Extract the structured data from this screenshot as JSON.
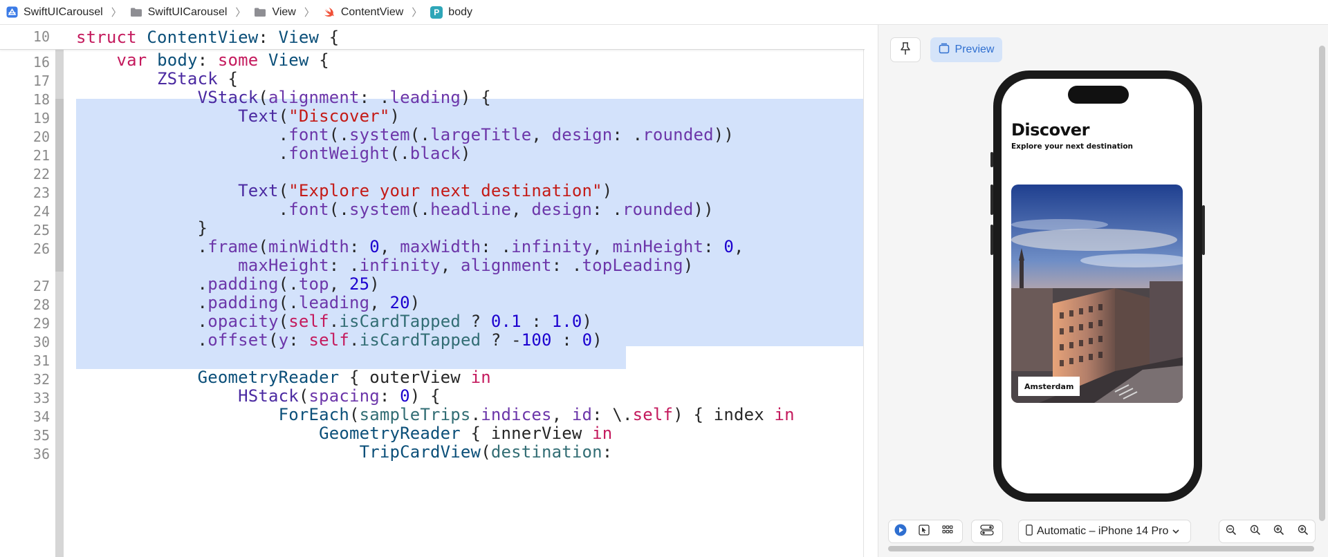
{
  "breadcrumb": {
    "items": [
      {
        "label": "SwiftUICarousel",
        "icon": "app-project-icon"
      },
      {
        "label": "SwiftUICarousel",
        "icon": "folder-icon"
      },
      {
        "label": "View",
        "icon": "folder-icon"
      },
      {
        "label": "ContentView",
        "icon": "swift-file-icon"
      },
      {
        "label": "body",
        "icon": "property-icon"
      }
    ],
    "property_badge": "P"
  },
  "editor": {
    "sticky": {
      "number": "10",
      "segments": [
        {
          "t": "struct",
          "c": "kw"
        },
        {
          "t": " ",
          "c": "pl"
        },
        {
          "t": "ContentView",
          "c": "ty"
        },
        {
          "t": ": ",
          "c": "pl"
        },
        {
          "t": "View",
          "c": "ty"
        },
        {
          "t": " {",
          "c": "pl"
        }
      ]
    },
    "lines": [
      {
        "number": "16",
        "segments": [
          {
            "t": "    ",
            "c": "pl"
          },
          {
            "t": "var",
            "c": "kw"
          },
          {
            "t": " ",
            "c": "pl"
          },
          {
            "t": "body",
            "c": "ty"
          },
          {
            "t": ": ",
            "c": "pl"
          },
          {
            "t": "some",
            "c": "kw"
          },
          {
            "t": " ",
            "c": "pl"
          },
          {
            "t": "View",
            "c": "ty"
          },
          {
            "t": " {",
            "c": "pl"
          }
        ]
      },
      {
        "number": "17",
        "segments": [
          {
            "t": "        ",
            "c": "pl"
          },
          {
            "t": "ZStack",
            "c": "fn"
          },
          {
            "t": " {",
            "c": "pl"
          }
        ]
      },
      {
        "number": "18",
        "segments": [
          {
            "t": "            ",
            "c": "pl"
          },
          {
            "t": "VStack",
            "c": "fn"
          },
          {
            "t": "(",
            "c": "pl"
          },
          {
            "t": "alignment",
            "c": "prm"
          },
          {
            "t": ": .",
            "c": "pl"
          },
          {
            "t": "leading",
            "c": "mem"
          },
          {
            "t": ") {",
            "c": "pl"
          }
        ]
      },
      {
        "number": "19",
        "segments": [
          {
            "t": "                ",
            "c": "pl"
          },
          {
            "t": "Text",
            "c": "fn"
          },
          {
            "t": "(",
            "c": "pl"
          },
          {
            "t": "\"Discover\"",
            "c": "str"
          },
          {
            "t": ")",
            "c": "pl"
          }
        ]
      },
      {
        "number": "20",
        "segments": [
          {
            "t": "                    .",
            "c": "pl"
          },
          {
            "t": "font",
            "c": "mem"
          },
          {
            "t": "(.",
            "c": "pl"
          },
          {
            "t": "system",
            "c": "mem"
          },
          {
            "t": "(.",
            "c": "pl"
          },
          {
            "t": "largeTitle",
            "c": "mem"
          },
          {
            "t": ", ",
            "c": "pl"
          },
          {
            "t": "design",
            "c": "prm"
          },
          {
            "t": ": .",
            "c": "pl"
          },
          {
            "t": "rounded",
            "c": "mem"
          },
          {
            "t": "))",
            "c": "pl"
          }
        ]
      },
      {
        "number": "21",
        "segments": [
          {
            "t": "                    .",
            "c": "pl"
          },
          {
            "t": "fontWeight",
            "c": "mem"
          },
          {
            "t": "(.",
            "c": "pl"
          },
          {
            "t": "black",
            "c": "mem"
          },
          {
            "t": ")",
            "c": "pl"
          }
        ]
      },
      {
        "number": "22",
        "segments": []
      },
      {
        "number": "23",
        "segments": [
          {
            "t": "                ",
            "c": "pl"
          },
          {
            "t": "Text",
            "c": "fn"
          },
          {
            "t": "(",
            "c": "pl"
          },
          {
            "t": "\"Explore your next destination\"",
            "c": "str"
          },
          {
            "t": ")",
            "c": "pl"
          }
        ]
      },
      {
        "number": "24",
        "segments": [
          {
            "t": "                    .",
            "c": "pl"
          },
          {
            "t": "font",
            "c": "mem"
          },
          {
            "t": "(.",
            "c": "pl"
          },
          {
            "t": "system",
            "c": "mem"
          },
          {
            "t": "(.",
            "c": "pl"
          },
          {
            "t": "headline",
            "c": "mem"
          },
          {
            "t": ", ",
            "c": "pl"
          },
          {
            "t": "design",
            "c": "prm"
          },
          {
            "t": ": .",
            "c": "pl"
          },
          {
            "t": "rounded",
            "c": "mem"
          },
          {
            "t": "))",
            "c": "pl"
          }
        ]
      },
      {
        "number": "25",
        "segments": [
          {
            "t": "            }",
            "c": "pl"
          }
        ]
      },
      {
        "number": "26",
        "segments": [
          {
            "t": "            .",
            "c": "pl"
          },
          {
            "t": "frame",
            "c": "mem"
          },
          {
            "t": "(",
            "c": "pl"
          },
          {
            "t": "minWidth",
            "c": "prm"
          },
          {
            "t": ": ",
            "c": "pl"
          },
          {
            "t": "0",
            "c": "num"
          },
          {
            "t": ", ",
            "c": "pl"
          },
          {
            "t": "maxWidth",
            "c": "prm"
          },
          {
            "t": ": .",
            "c": "pl"
          },
          {
            "t": "infinity",
            "c": "mem"
          },
          {
            "t": ", ",
            "c": "pl"
          },
          {
            "t": "minHeight",
            "c": "prm"
          },
          {
            "t": ": ",
            "c": "pl"
          },
          {
            "t": "0",
            "c": "num"
          },
          {
            "t": ",",
            "c": "pl"
          }
        ]
      },
      {
        "number": "",
        "segments": [
          {
            "t": "                ",
            "c": "pl"
          },
          {
            "t": "maxHeight",
            "c": "prm"
          },
          {
            "t": ": .",
            "c": "pl"
          },
          {
            "t": "infinity",
            "c": "mem"
          },
          {
            "t": ", ",
            "c": "pl"
          },
          {
            "t": "alignment",
            "c": "prm"
          },
          {
            "t": ": .",
            "c": "pl"
          },
          {
            "t": "topLeading",
            "c": "mem"
          },
          {
            "t": ")",
            "c": "pl"
          }
        ]
      },
      {
        "number": "27",
        "segments": [
          {
            "t": "            .",
            "c": "pl"
          },
          {
            "t": "padding",
            "c": "mem"
          },
          {
            "t": "(.",
            "c": "pl"
          },
          {
            "t": "top",
            "c": "mem"
          },
          {
            "t": ", ",
            "c": "pl"
          },
          {
            "t": "25",
            "c": "num"
          },
          {
            "t": ")",
            "c": "pl"
          }
        ]
      },
      {
        "number": "28",
        "segments": [
          {
            "t": "            .",
            "c": "pl"
          },
          {
            "t": "padding",
            "c": "mem"
          },
          {
            "t": "(.",
            "c": "pl"
          },
          {
            "t": "leading",
            "c": "mem"
          },
          {
            "t": ", ",
            "c": "pl"
          },
          {
            "t": "20",
            "c": "num"
          },
          {
            "t": ")",
            "c": "pl"
          }
        ]
      },
      {
        "number": "29",
        "segments": [
          {
            "t": "            .",
            "c": "pl"
          },
          {
            "t": "opacity",
            "c": "mem"
          },
          {
            "t": "(",
            "c": "pl"
          },
          {
            "t": "self",
            "c": "kw"
          },
          {
            "t": ".",
            "c": "pl"
          },
          {
            "t": "isCardTapped",
            "c": "var"
          },
          {
            "t": " ? ",
            "c": "pl"
          },
          {
            "t": "0.1",
            "c": "num"
          },
          {
            "t": " : ",
            "c": "pl"
          },
          {
            "t": "1.0",
            "c": "num"
          },
          {
            "t": ")",
            "c": "pl"
          }
        ]
      },
      {
        "number": "30",
        "segments": [
          {
            "t": "            .",
            "c": "pl"
          },
          {
            "t": "offset",
            "c": "mem"
          },
          {
            "t": "(",
            "c": "pl"
          },
          {
            "t": "y",
            "c": "prm"
          },
          {
            "t": ": ",
            "c": "pl"
          },
          {
            "t": "self",
            "c": "kw"
          },
          {
            "t": ".",
            "c": "pl"
          },
          {
            "t": "isCardTapped",
            "c": "var"
          },
          {
            "t": " ? -",
            "c": "pl"
          },
          {
            "t": "100",
            "c": "num"
          },
          {
            "t": " : ",
            "c": "pl"
          },
          {
            "t": "0",
            "c": "num"
          },
          {
            "t": ")",
            "c": "pl"
          }
        ]
      },
      {
        "number": "31",
        "segments": []
      },
      {
        "number": "32",
        "segments": [
          {
            "t": "            ",
            "c": "pl"
          },
          {
            "t": "GeometryReader",
            "c": "ty"
          },
          {
            "t": " { outerView ",
            "c": "pl"
          },
          {
            "t": "in",
            "c": "kw"
          }
        ]
      },
      {
        "number": "33",
        "segments": [
          {
            "t": "                ",
            "c": "pl"
          },
          {
            "t": "HStack",
            "c": "fn"
          },
          {
            "t": "(",
            "c": "pl"
          },
          {
            "t": "spacing",
            "c": "prm"
          },
          {
            "t": ": ",
            "c": "pl"
          },
          {
            "t": "0",
            "c": "num"
          },
          {
            "t": ") {",
            "c": "pl"
          }
        ]
      },
      {
        "number": "34",
        "segments": [
          {
            "t": "                    ",
            "c": "pl"
          },
          {
            "t": "ForEach",
            "c": "ty"
          },
          {
            "t": "(",
            "c": "pl"
          },
          {
            "t": "sampleTrips",
            "c": "var"
          },
          {
            "t": ".",
            "c": "pl"
          },
          {
            "t": "indices",
            "c": "mem"
          },
          {
            "t": ", ",
            "c": "pl"
          },
          {
            "t": "id",
            "c": "prm"
          },
          {
            "t": ": \\.",
            "c": "pl"
          },
          {
            "t": "self",
            "c": "kw"
          },
          {
            "t": ") { index ",
            "c": "pl"
          },
          {
            "t": "in",
            "c": "kw"
          }
        ]
      },
      {
        "number": "35",
        "segments": [
          {
            "t": "                        ",
            "c": "pl"
          },
          {
            "t": "GeometryReader",
            "c": "ty"
          },
          {
            "t": " { innerView ",
            "c": "pl"
          },
          {
            "t": "in",
            "c": "kw"
          }
        ]
      },
      {
        "number": "36",
        "segments": [
          {
            "t": "                            ",
            "c": "pl"
          },
          {
            "t": "TripCardView",
            "c": "ty"
          },
          {
            "t": "(",
            "c": "pl"
          },
          {
            "t": "destination",
            "c": "var"
          },
          {
            "t": ":",
            "c": "pl"
          }
        ]
      }
    ]
  },
  "preview": {
    "pin_icon": "pin-icon",
    "preview_label": "Preview",
    "app_title": "Discover",
    "app_subtitle": "Explore your next destination",
    "card_label": "Amsterdam",
    "device_label": "Automatic – iPhone 14 Pro"
  },
  "colors": {
    "selection": "#d3e2fb",
    "keyword": "#c41a5d",
    "string": "#c41a16",
    "number": "#1c00cf",
    "accent": "#2f6fd0"
  }
}
